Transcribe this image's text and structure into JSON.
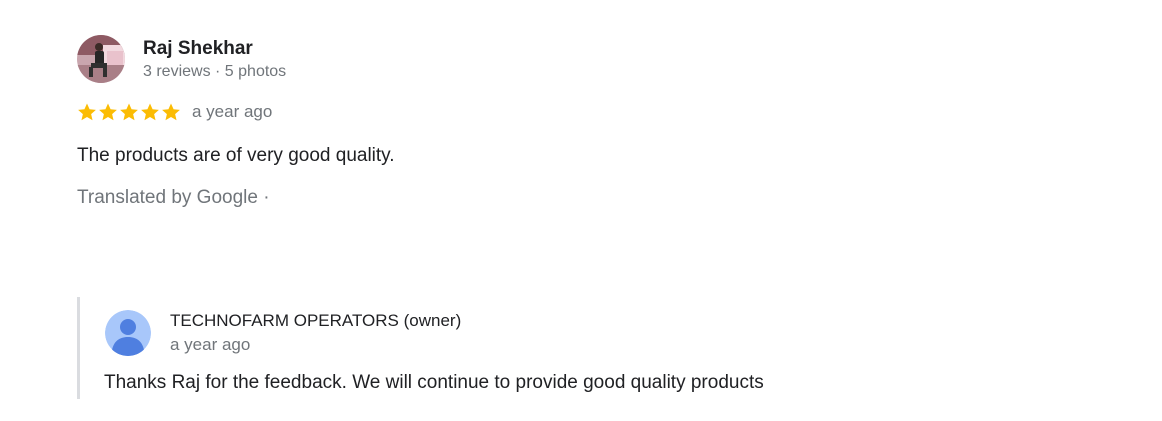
{
  "review": {
    "author_name": "Raj Shekhar",
    "author_meta": "3 reviews · 5 photos",
    "rating": 5,
    "rating_max": 5,
    "star_color": "#fbbc04",
    "time": "a year ago",
    "text": "The products are of very good quality.",
    "translated_label": "Translated by Google ·"
  },
  "owner_reply": {
    "name": "TECHNOFARM OPERATORS (owner)",
    "time": "a year ago",
    "text": "Thanks Raj for the feedback. We will continue to provide good quality products",
    "avatar_icon": "default-person-icon"
  }
}
